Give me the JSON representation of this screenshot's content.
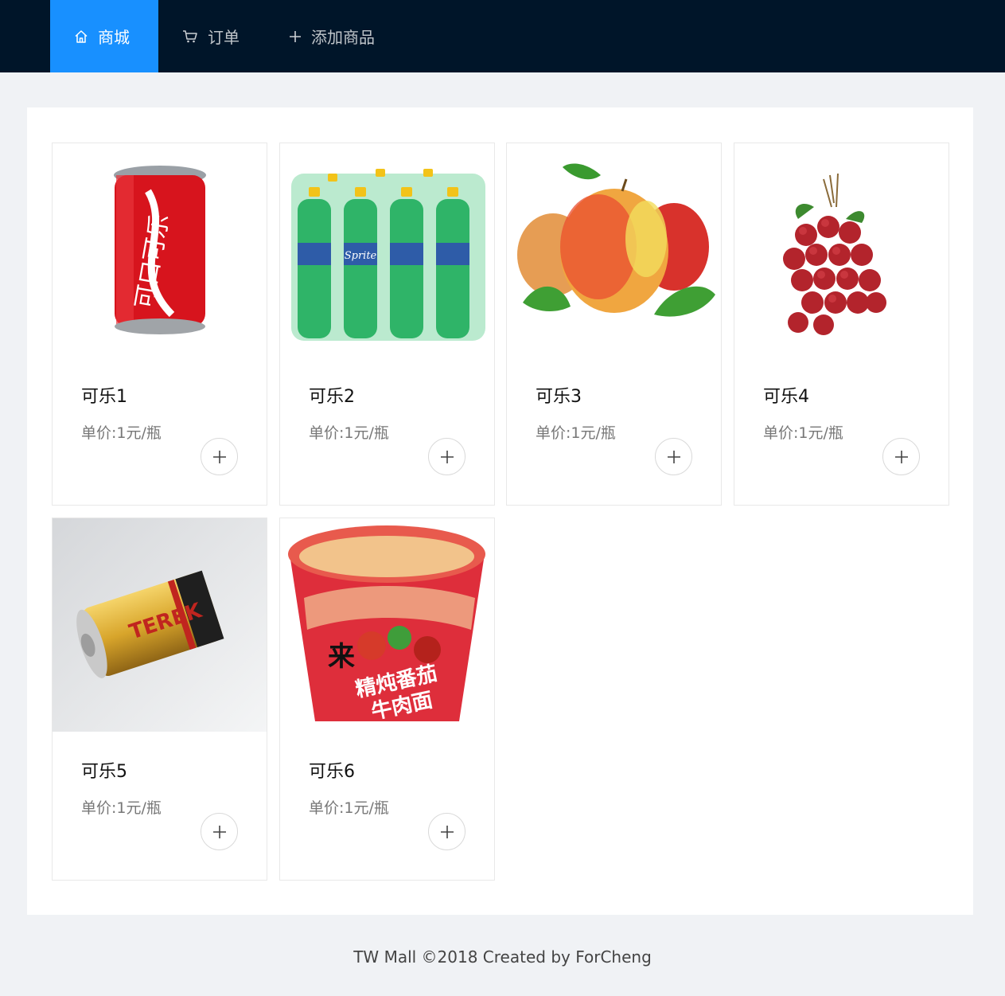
{
  "nav": {
    "items": [
      {
        "label": "商城",
        "icon": "home-icon",
        "active": true
      },
      {
        "label": "订单",
        "icon": "cart-icon",
        "active": false
      },
      {
        "label": "添加商品",
        "icon": "plus-icon",
        "active": false
      }
    ]
  },
  "products": [
    {
      "name": "可乐1",
      "price": "单价:1元/瓶",
      "image": "cola-can"
    },
    {
      "name": "可乐2",
      "price": "单价:1元/瓶",
      "image": "sprite-bottles"
    },
    {
      "name": "可乐3",
      "price": "单价:1元/瓶",
      "image": "apples"
    },
    {
      "name": "可乐4",
      "price": "单价:1元/瓶",
      "image": "lychee"
    },
    {
      "name": "可乐5",
      "price": "单价:1元/瓶",
      "image": "battery"
    },
    {
      "name": "可乐6",
      "price": "单价:1元/瓶",
      "image": "instant-noodles"
    }
  ],
  "footer": {
    "text": "TW Mall ©2018 Created by ForCheng"
  },
  "colors": {
    "header_bg": "#001529",
    "active_nav": "#1890ff",
    "page_bg": "#f0f2f5"
  }
}
